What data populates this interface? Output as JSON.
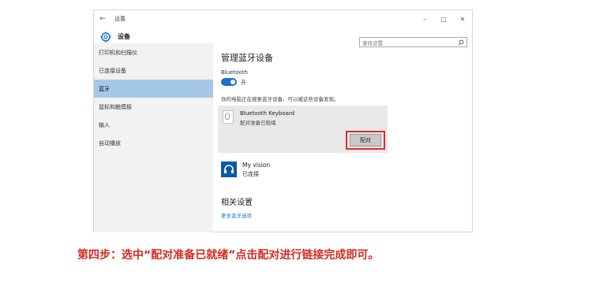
{
  "window": {
    "title": "设置",
    "controls": [
      "–",
      "□",
      "✕"
    ],
    "back_glyph": "←"
  },
  "header": {
    "app_name": "设备",
    "search_placeholder": "查找设置"
  },
  "sidebar": {
    "items": [
      {
        "label": "打印机和扫描仪",
        "active": false
      },
      {
        "label": "已连接设备",
        "active": false
      },
      {
        "label": "蓝牙",
        "active": true
      },
      {
        "label": "鼠标和触摸板",
        "active": false
      },
      {
        "label": "输入",
        "active": false
      },
      {
        "label": "自动播放",
        "active": false
      }
    ]
  },
  "main": {
    "title": "管理蓝牙设备",
    "bluetooth_label": "Bluetooth",
    "toggle_state": "开",
    "search_desc": "你的电脑正在搜索蓝牙设备，可以被这些设备发现。",
    "devices": [
      {
        "name": "Bluetooth Keyboard",
        "status": "配对准备已就绪",
        "action": "配对",
        "icon": "keyboard-icon"
      },
      {
        "name": "My vision",
        "status": "已连接",
        "icon": "headset-icon"
      }
    ],
    "related_title": "相关设置",
    "related_link": "更多蓝牙选项"
  },
  "instruction": "第四步：选中“配对准备已就绪”点击配对进行链接完成即可。",
  "colors": {
    "accent": "#1b73c9",
    "active_sidebar": "#a6c8e8",
    "highlight": "#e12a2a",
    "instruction_text": "#d6281f"
  }
}
